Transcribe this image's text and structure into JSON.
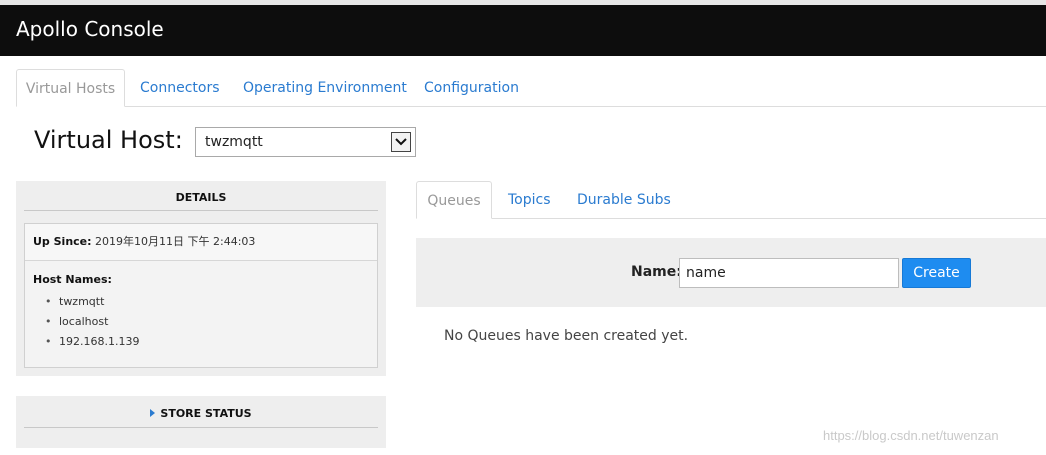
{
  "app": {
    "title": "Apollo Console"
  },
  "main_tabs": [
    {
      "label": "Virtual Hosts",
      "active": true
    },
    {
      "label": "Connectors",
      "active": false
    },
    {
      "label": "Operating Environment",
      "active": false
    },
    {
      "label": "Configuration",
      "active": false
    }
  ],
  "virtual_host": {
    "label": "Virtual Host:",
    "selected": "twzmqtt"
  },
  "details": {
    "title": "DETAILS",
    "up_since_label": "Up Since:",
    "up_since_value": "2019年10月11日 下午 2:44:03",
    "host_names_label": "Host Names:",
    "host_names": [
      "twzmqtt",
      "localhost",
      "192.168.1.139"
    ]
  },
  "store_status": {
    "title": "STORE STATUS"
  },
  "sub_tabs": [
    {
      "label": "Queues",
      "active": true
    },
    {
      "label": "Topics",
      "active": false
    },
    {
      "label": "Durable Subs",
      "active": false
    }
  ],
  "create_form": {
    "name_label": "Name:",
    "name_value": "name",
    "create_label": "Create"
  },
  "empty_message": "No Queues have been created yet.",
  "watermark": "https://blog.csdn.net/tuwenzan",
  "colors": {
    "navbar": "#0d0d0d",
    "link": "#2a7bd0",
    "button": "#1e8cf0",
    "panel": "#eeeeee"
  }
}
